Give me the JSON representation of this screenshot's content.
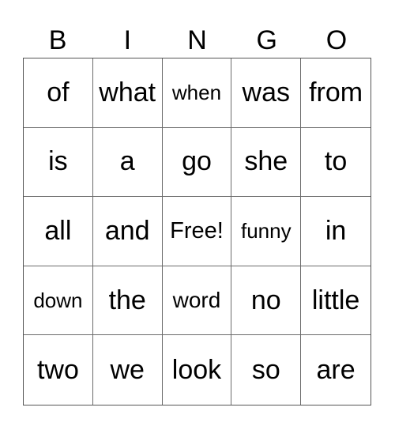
{
  "header": [
    "B",
    "I",
    "N",
    "G",
    "O"
  ],
  "cells": [
    [
      "of",
      "what",
      "when",
      "was",
      "from"
    ],
    [
      "is",
      "a",
      "go",
      "she",
      "to"
    ],
    [
      "all",
      "and",
      "Free!",
      "funny",
      "in"
    ],
    [
      "down",
      "the",
      "word",
      "no",
      "little"
    ],
    [
      "two",
      "we",
      "look",
      "so",
      "are"
    ]
  ]
}
